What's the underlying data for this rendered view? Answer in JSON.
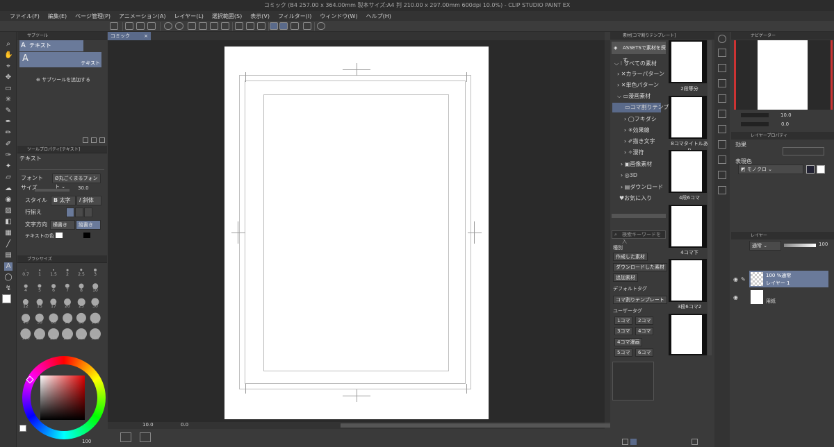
{
  "window": {
    "title": "コミック (B4 257.00 x 364.00mm 製本サイズ:A4 判 210.00 x 297.00mm 600dpi 10.0%) - CLIP STUDIO PAINT EX"
  },
  "menu": [
    "ファイル(F)",
    "編集(E)",
    "ページ管理(P)",
    "アニメーション(A)",
    "レイヤー(L)",
    "選択範囲(S)",
    "表示(V)",
    "フィルター(I)",
    "ウィンドウ(W)",
    "ヘルプ(H)"
  ],
  "subtool": {
    "tab": "サブツール",
    "group_label": "テキスト",
    "item_label": "テキスト",
    "add_label": "サブツールを追加する"
  },
  "toolprop": {
    "tab": "ツールプロパティ[テキスト]",
    "title": "テキスト",
    "font_label": "フォント",
    "font_value": "Ø丸ごくまるフォント",
    "size_label": "サイズ",
    "size_value": "30.0",
    "style_label": "スタイル",
    "bold_label": "太字",
    "italic_label": "斜体",
    "align_label": "行揃え",
    "direction_label": "文字方向",
    "horizontal_label": "横書き",
    "vertical_label": "縦書き",
    "color_label": "テキストの色"
  },
  "brushsize": {
    "tab": "ブラシサイズ",
    "sizes": [
      "0.7",
      "1",
      "1.5",
      "2",
      "2.5",
      "3",
      "4",
      "5",
      "6",
      "7",
      "8",
      "10",
      "12",
      "15",
      "17",
      "20",
      "25",
      "30",
      "40",
      "50",
      "60",
      "70",
      "80",
      "100",
      "120",
      "150",
      "170",
      "200",
      "250",
      "300"
    ]
  },
  "color": {
    "opacity_value": "100"
  },
  "canvas": {
    "tab": "コミック",
    "zoom_value": "10.0",
    "angle_value": "0.0"
  },
  "material": {
    "tab": "素材[コマ割りテンプレート]",
    "assets_label": "ASSETSで素材を探す",
    "tree": [
      "すべての素材",
      "カラーパターン",
      "単色パターン",
      "漫画素材",
      "コマ割りテンプ",
      "フキダシ",
      "効果線",
      "描き文字",
      "漫符",
      "画像素材",
      "3D",
      "ダウンロード",
      "お気に入り"
    ],
    "thumbs": [
      "2段等分",
      "8コマタイトルあり",
      "4段6コマ",
      "4コマ下",
      "3段6コマ2",
      ""
    ],
    "search_placeholder": "検索キーワードを入",
    "type_label": "種別",
    "type_buttons": [
      "作成した素材",
      "ダウンロードした素材",
      "追加素材"
    ],
    "default_tag_label": "デフォルトタグ",
    "default_tag_button": "コマ割りテンプレート",
    "user_tag_label": "ユーザータグ",
    "user_tags": [
      "1コマ",
      "2コマ",
      "3コマ",
      "4コマ",
      "4コマ漫画",
      "5コマ",
      "6コマ"
    ]
  },
  "navigator": {
    "tab": "ナビゲーター",
    "zoom_value": "10.0",
    "angle_value": "0.0"
  },
  "layerprop": {
    "tab": "レイヤープロパティ",
    "effect_label": "効果",
    "expression_label": "表現色",
    "expression_value": "モノクロ"
  },
  "layers": {
    "tab": "レイヤー",
    "blend_value": "通常",
    "opacity_value": "100",
    "items": [
      {
        "info": "100 %通常",
        "name": "レイヤー 1"
      },
      {
        "info": "",
        "name": "用紙"
      }
    ]
  }
}
